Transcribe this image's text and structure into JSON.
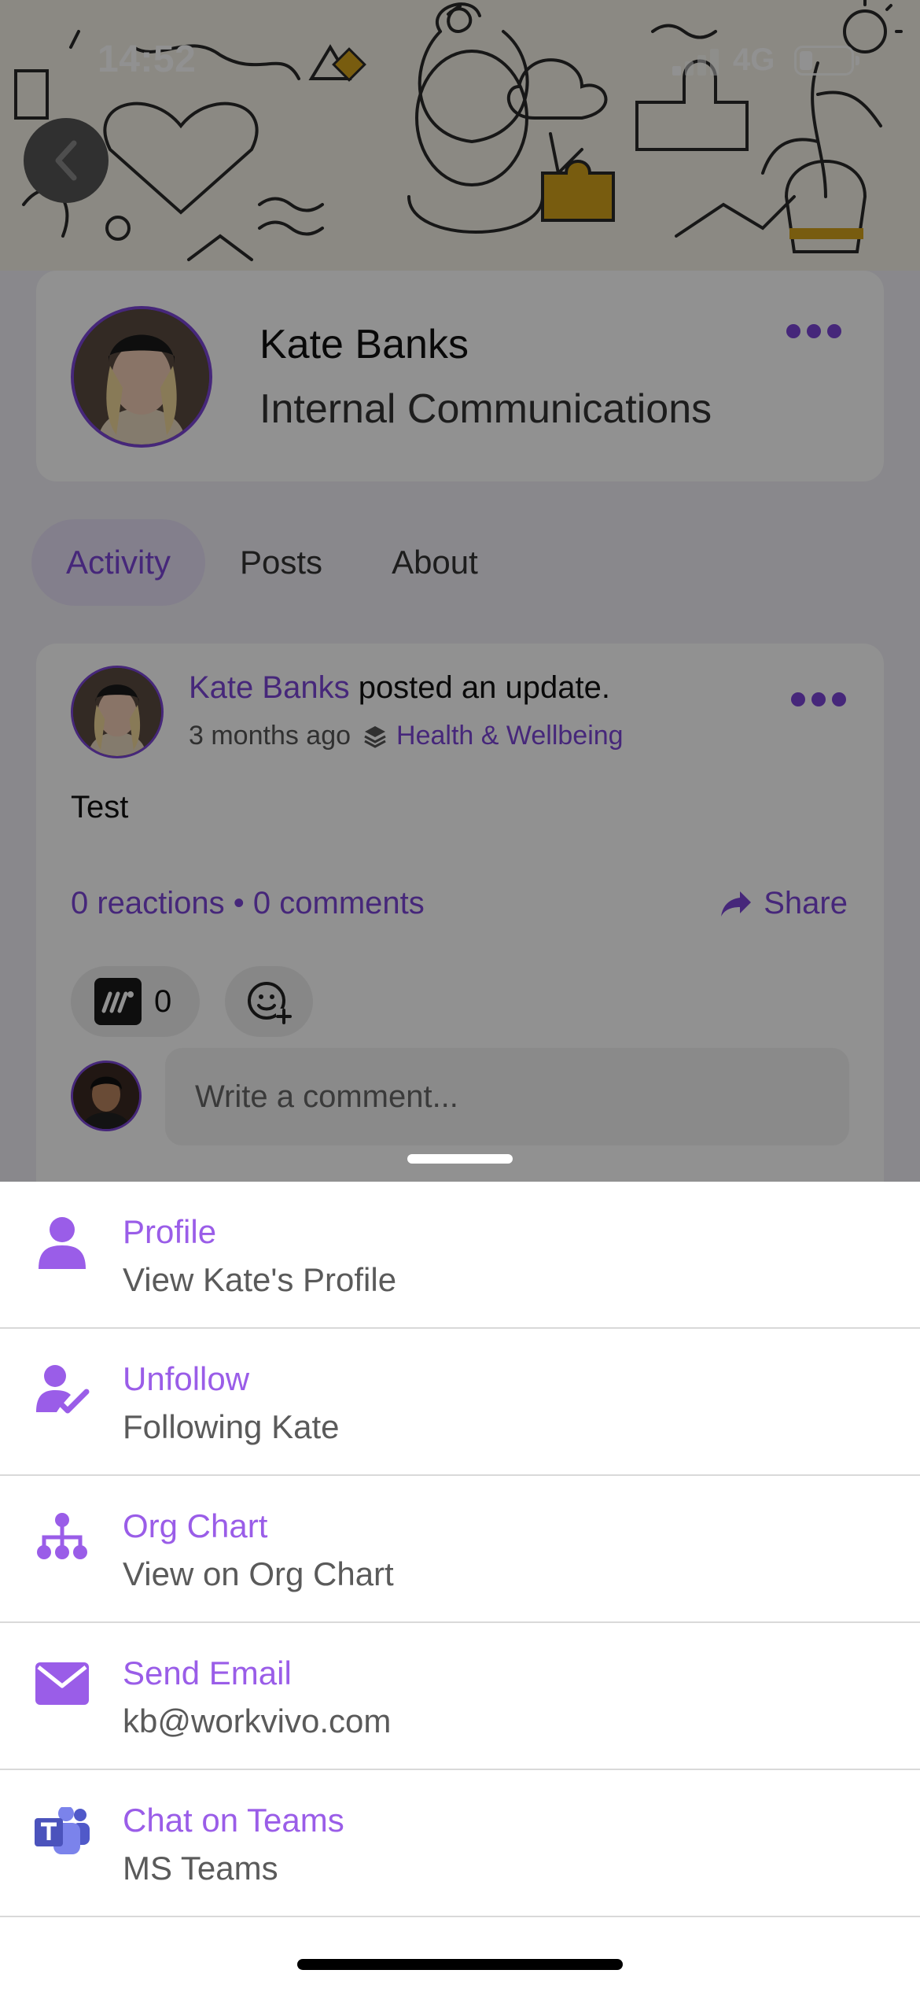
{
  "status_bar": {
    "time": "14:52",
    "network": "4G"
  },
  "profile": {
    "name": "Kate Banks",
    "title": "Internal Communications"
  },
  "tabs": [
    {
      "label": "Activity",
      "active": true
    },
    {
      "label": "Posts",
      "active": false
    },
    {
      "label": "About",
      "active": false
    }
  ],
  "post": {
    "author": "Kate Banks",
    "action": " posted an update.",
    "time_ago": "3 months ago",
    "space": "Health & Wellbeing",
    "body": "Test",
    "stats": "0 reactions • 0 comments",
    "share_label": "Share",
    "reaction_count": "0",
    "comment_placeholder": "Write a comment..."
  },
  "sheet": {
    "items": [
      {
        "label": "Profile",
        "sub": "View Kate's Profile",
        "icon": "person-icon"
      },
      {
        "label": "Unfollow",
        "sub": "Following Kate",
        "icon": "person-check-icon"
      },
      {
        "label": "Org Chart",
        "sub": "View on Org Chart",
        "icon": "org-chart-icon"
      },
      {
        "label": "Send Email",
        "sub": "kb@workvivo.com",
        "icon": "envelope-icon"
      },
      {
        "label": "Chat on Teams",
        "sub": "MS Teams",
        "icon": "ms-teams-icon"
      }
    ]
  },
  "colors": {
    "accent": "#7b45d6",
    "sheet_accent": "#9a5de8",
    "overlay": "rgba(0,0,0,0.43)"
  }
}
